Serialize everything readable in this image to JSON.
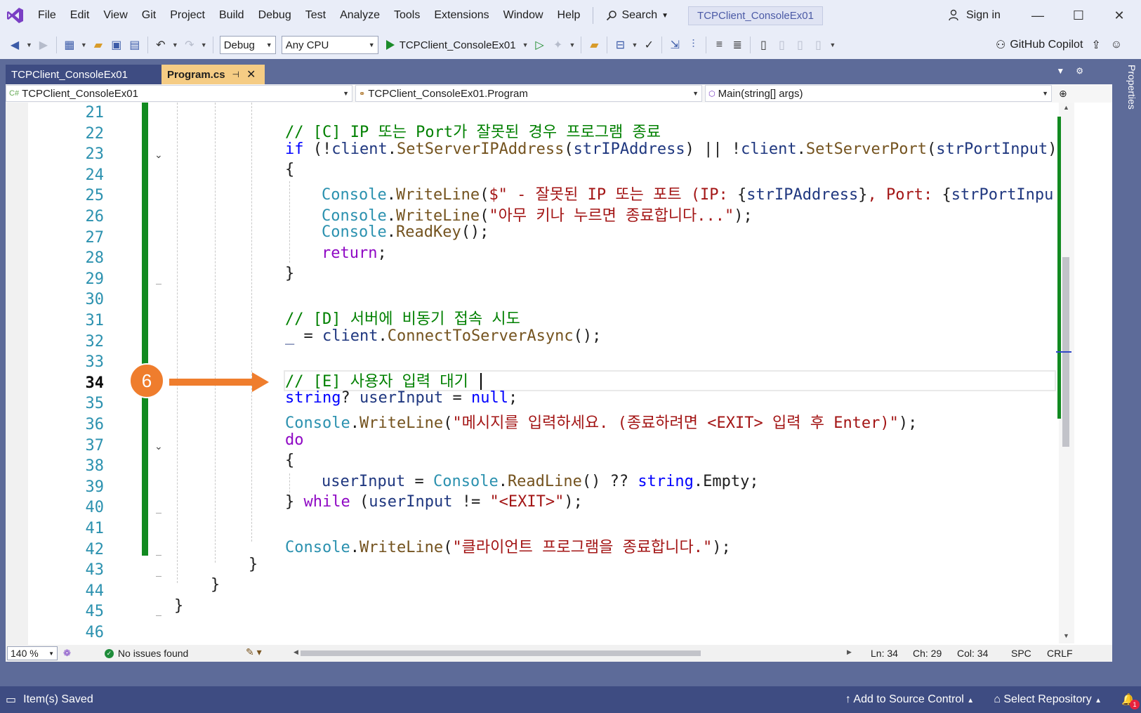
{
  "menu": {
    "items": [
      "File",
      "Edit",
      "View",
      "Git",
      "Project",
      "Build",
      "Debug",
      "Test",
      "Analyze",
      "Tools",
      "Extensions",
      "Window",
      "Help"
    ],
    "search_label": "Search",
    "solution_title": "TCPClient_ConsoleEx01",
    "sign_in": "Sign in"
  },
  "toolbar": {
    "configuration": "Debug",
    "platform": "Any CPU",
    "start_target": "TCPClient_ConsoleEx01",
    "copilot_label": "GitHub Copilot"
  },
  "tabs": {
    "project_tab": "TCPClient_ConsoleEx01",
    "active_tab": "Program.cs"
  },
  "navbar": {
    "project": "TCPClient_ConsoleEx01",
    "type": "TCPClient_ConsoleEx01.Program",
    "member": "Main(string[] args)"
  },
  "editor": {
    "current_line": 34,
    "line_numbers": [
      21,
      22,
      23,
      24,
      25,
      26,
      27,
      28,
      29,
      30,
      31,
      32,
      33,
      34,
      35,
      36,
      37,
      38,
      39,
      40,
      41,
      42,
      43,
      44,
      45,
      46
    ],
    "code": {
      "l22": "// [C] IP 또는 Port가 잘못된 경우 프로그램 종료",
      "l23_if": "if",
      "l23_a": " (!",
      "l23_client": "client",
      "l23_dot": ".",
      "l23_m1": "SetServerIPAddress",
      "l23_p1": "(",
      "l23_v1": "strIPAddress",
      "l23_or": ") || !",
      "l23_client2": "client",
      "l23_dot2": ".",
      "l23_m2": "SetServerPort",
      "l23_p2": "(",
      "l23_v2": "strPortInput",
      "l23_end": ")",
      "l24": "{",
      "l25_cls": "Console",
      "l25_dot": ".",
      "l25_m": "WriteLine",
      "l25_p": "(",
      "l25_s1": "$\" - 잘못된 IP 또는 포트 (IP: ",
      "l25_b1": "{",
      "l25_v1": "strIPAddress",
      "l25_b2": "}",
      "l25_s2": ", Port: ",
      "l25_b3": "{",
      "l25_v2": "strPortInpu",
      "l26_cls": "Console",
      "l26_dot": ".",
      "l26_m": "WriteLine",
      "l26_p": "(",
      "l26_s": "\"아무 키나 누르면 종료합니다...\"",
      "l26_end": ");",
      "l27_cls": "Console",
      "l27_dot": ".",
      "l27_m": "ReadKey",
      "l27_end": "();",
      "l28_kw": "return",
      "l28_end": ";",
      "l29": "}",
      "l31": "// [D] 서버에 비동기 접속 시도",
      "l32_v": "_",
      "l32_eq": " = ",
      "l32_client": "client",
      "l32_dot": ".",
      "l32_m": "ConnectToServerAsync",
      "l32_end": "();",
      "l34": "// [E] 사용자 입력 대기",
      "l35_kw": "string",
      "l35_q": "? ",
      "l35_v": "userInput",
      "l35_eq": " = ",
      "l35_null": "null",
      "l35_end": ";",
      "l36_cls": "Console",
      "l36_dot": ".",
      "l36_m": "WriteLine",
      "l36_p": "(",
      "l36_s": "\"메시지를 입력하세요. (종료하려면 <EXIT> 입력 후 Enter)\"",
      "l36_end": ");",
      "l37_kw": "do",
      "l38": "{",
      "l39_v": "userInput",
      "l39_eq": " = ",
      "l39_cls": "Console",
      "l39_dot": ".",
      "l39_m": "ReadLine",
      "l39_mid": "() ?? ",
      "l39_kw": "string",
      "l39_dot2": ".",
      "l39_prop": "Empty;",
      "l40_close": "} ",
      "l40_kw": "while",
      "l40_p": " (",
      "l40_v": "userInput",
      "l40_ne": " != ",
      "l40_s": "\"<EXIT>\"",
      "l40_end": ");",
      "l42_cls": "Console",
      "l42_dot": ".",
      "l42_m": "WriteLine",
      "l42_p": "(",
      "l42_s": "\"클라이언트 프로그램을 종료합니다.\"",
      "l42_end": ");",
      "l43": "}",
      "l44": "}",
      "l45": "}"
    }
  },
  "callout": {
    "number": "6",
    "color": "#ef7d2d"
  },
  "editor_status": {
    "zoom": "140 %",
    "issues": "No issues found",
    "ln": "Ln: 34",
    "ch": "Ch: 29",
    "col": "Col: 34",
    "spc": "SPC",
    "crlf": "CRLF"
  },
  "side_panel": {
    "label": "Properties"
  },
  "statusbar": {
    "left": "Item(s) Saved",
    "source_control": "Add to Source Control",
    "repository": "Select Repository",
    "notifications": "1"
  },
  "colors": {
    "accent": "#5d6b99",
    "statusbar": "#3e4c82",
    "active_tab": "#f5cc84",
    "change_bar": "#118a20"
  }
}
